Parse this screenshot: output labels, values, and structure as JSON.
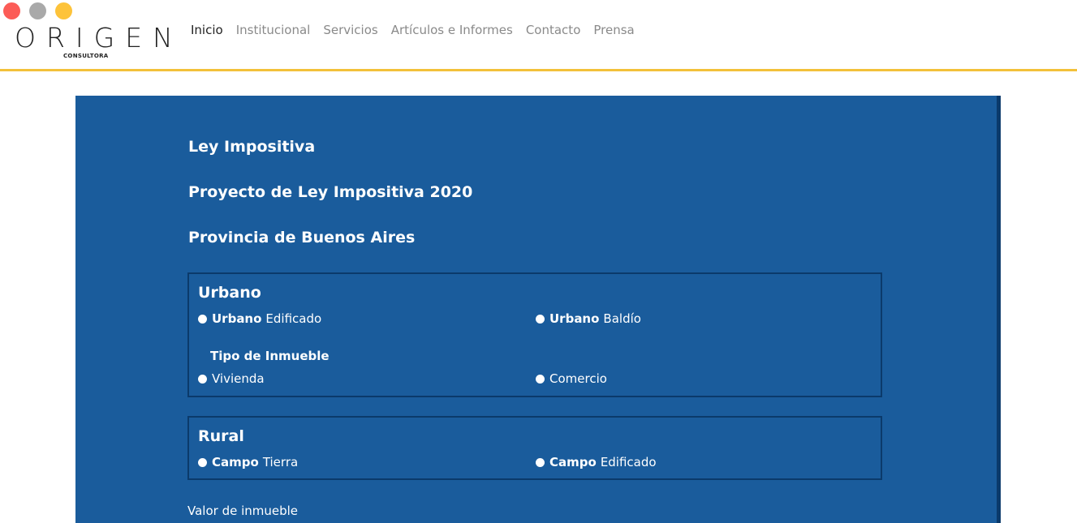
{
  "window": {
    "controls": [
      {
        "name": "close",
        "color": "#fc5c57"
      },
      {
        "name": "minimize",
        "color": "#a9a9a9"
      },
      {
        "name": "maximize",
        "color": "#fdc33a"
      }
    ]
  },
  "brand": {
    "name": "ORIGEN",
    "subtitle": "CONSULTORA"
  },
  "nav": {
    "items": [
      {
        "label": "Inicio",
        "active": true
      },
      {
        "label": "Institucional"
      },
      {
        "label": "Servicios"
      },
      {
        "label": "Artículos e Informes"
      },
      {
        "label": "Contacto"
      },
      {
        "label": "Prensa"
      }
    ]
  },
  "colors": {
    "accent": "#f3c13a",
    "panel": "#1a5c9c",
    "panel_border": "#0b3a6b"
  },
  "main": {
    "titles": [
      "Ley Impositiva",
      "Proyecto de Ley Impositiva 2020",
      "Provincia de Buenos Aires"
    ],
    "urbano": {
      "title": "Urbano",
      "options": [
        {
          "bold": "Urbano",
          "rest": "Edificado"
        },
        {
          "bold": "Urbano",
          "rest": "Baldío"
        }
      ],
      "tipo_label": "Tipo de Inmueble",
      "tipo_options": [
        "Vivienda",
        "Comercio"
      ]
    },
    "rural": {
      "title": "Rural",
      "options": [
        {
          "bold": "Campo",
          "rest": "Tierra"
        },
        {
          "bold": "Campo",
          "rest": "Edificado"
        }
      ]
    },
    "valor_label": "Valor de inmueble"
  }
}
